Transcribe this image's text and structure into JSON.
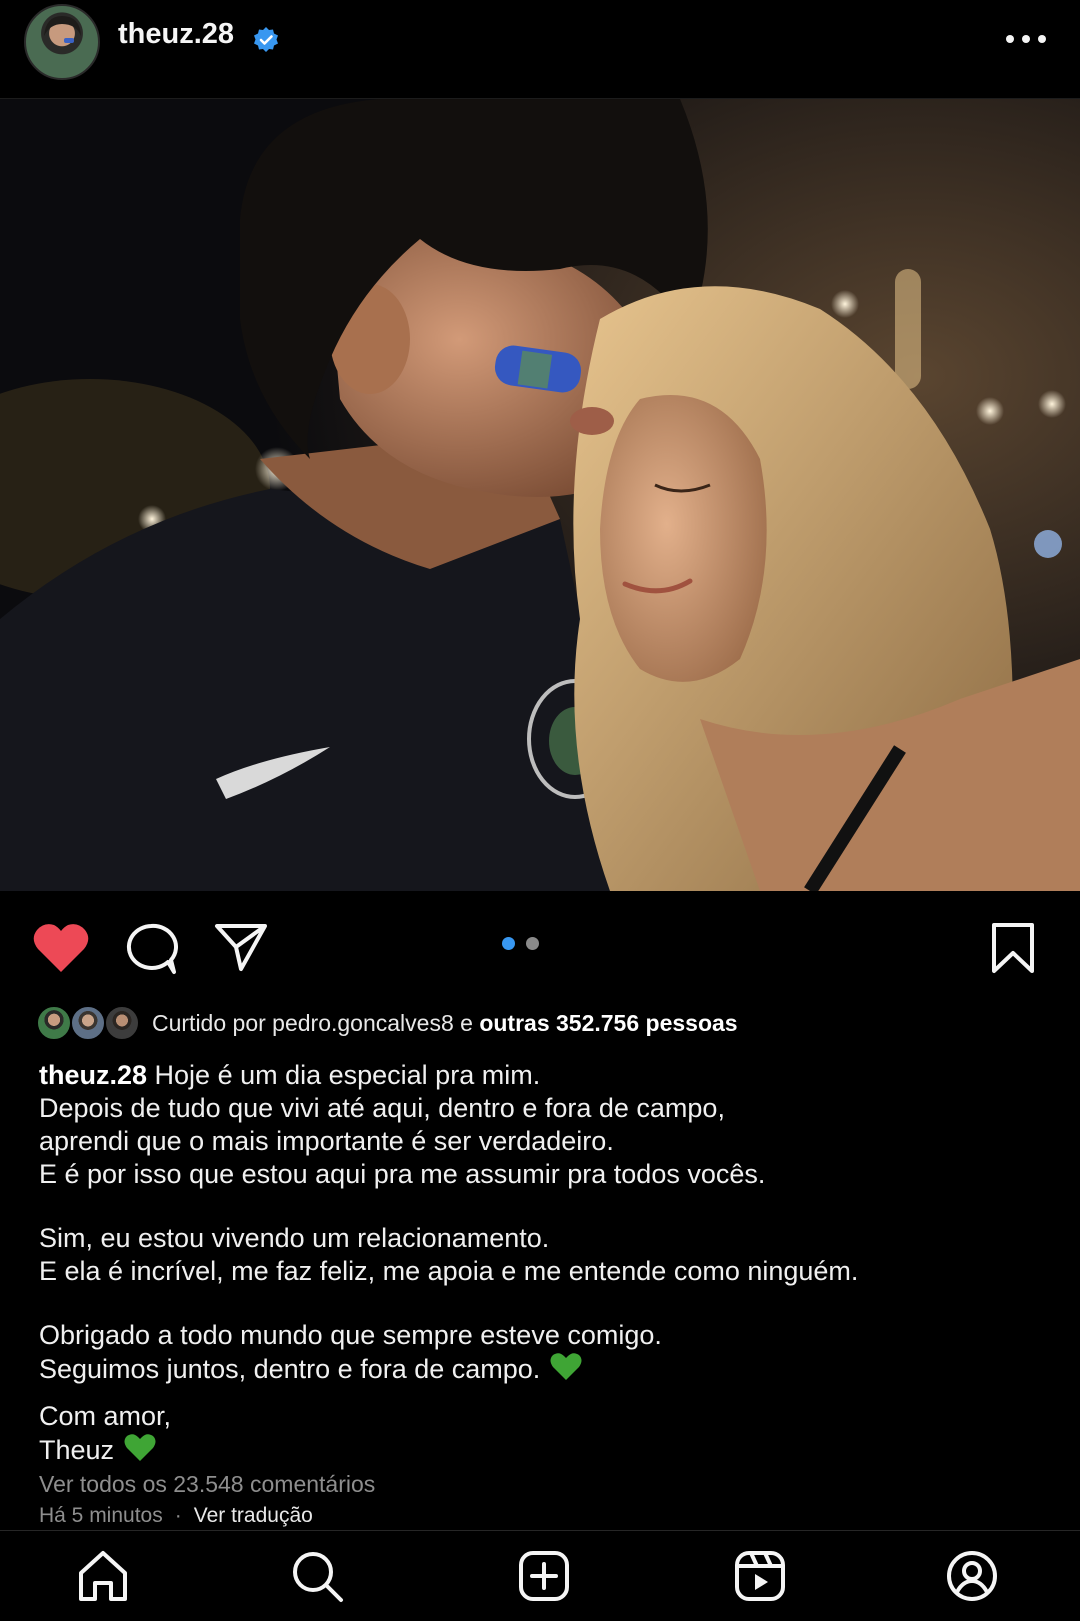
{
  "header": {
    "username": "theuz.28",
    "verified": true,
    "icons": {
      "avatar": "profile-avatar",
      "verified": "verified-badge-icon",
      "more": "more-options-icon"
    }
  },
  "post": {
    "image_description_icon": "photo",
    "carousel": {
      "count": 2,
      "active_index": 1
    },
    "actions": {
      "like": "heart-filled-icon",
      "comment": "comment-icon",
      "share": "send-icon",
      "save": "bookmark-icon"
    },
    "liked": true
  },
  "likes": {
    "prefix": "Curtido por pedro.goncalves8 e ",
    "bold": "outras 352.756 pessoas"
  },
  "caption": {
    "username": "theuz.28",
    "line1": " Hoje é um dia especial pra mim.",
    "line2": "Depois de tudo que vivi até aqui, dentro e fora de campo,",
    "line3": "aprendi que o mais importante é ser verdadeiro.",
    "line4": "E é por isso que estou aqui pra me assumir pra todos vocês.",
    "line5": "Sim, eu estou vivendo um relacionamento.",
    "line6": "E ela é incrível, me faz feliz, me apoia e me entende como ninguém.",
    "line7": "Obrigado a todo mundo que sempre esteve comigo.",
    "line8": "Seguimos juntos, dentro e fora de campo.",
    "line9": "Com amor,",
    "line10": "Theuz",
    "emoji": "green-heart"
  },
  "comments": {
    "view_all": "Ver todos os 23.548 comentários"
  },
  "meta": {
    "time": "Há 5 minutos",
    "separator": "·",
    "translate": "Ver tradução"
  },
  "colors": {
    "accent": "#3897f0",
    "like": "#ed4956",
    "green_heart": "#3fa535",
    "muted": "#8e8e8e"
  },
  "bottom_nav": [
    "home-icon",
    "search-icon",
    "new-post-icon",
    "reels-icon",
    "profile-icon"
  ]
}
